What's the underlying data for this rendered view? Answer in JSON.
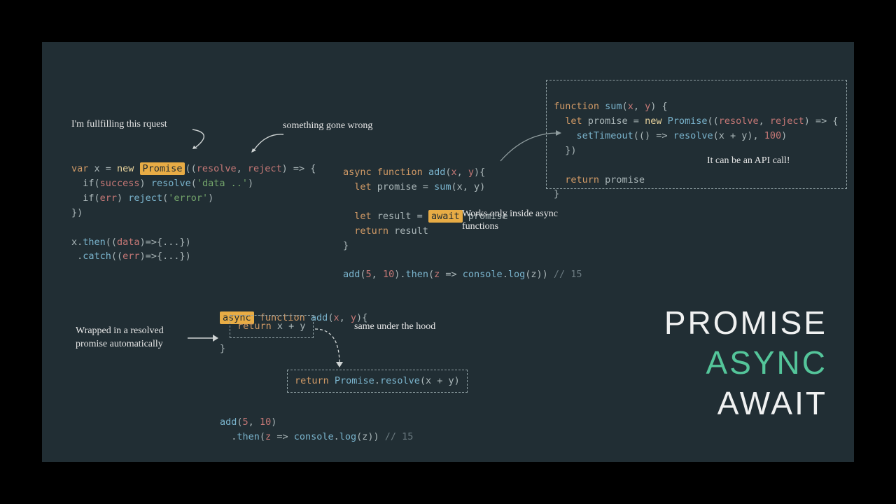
{
  "annotations": {
    "fulfilling": "I'm fullfilling this rquest",
    "wrong": "something gone wrong",
    "works_inside": "Works only inside async functions",
    "api_call": "It can be an API call!",
    "wrapped": "Wrapped in a resolved promise automatically",
    "same_hood": "same under the hood"
  },
  "titles": {
    "promise": "PROMISE",
    "async": "ASYNC",
    "await": "AWAIT"
  },
  "code": {
    "block1": {
      "l1a": "var",
      "l1b": " x = ",
      "l1c": "new ",
      "l1hl": "Promise",
      "l1d": "((",
      "l1e": "resolve",
      "l1f": ", ",
      "l1g": "reject",
      "l1h": ") => {",
      "l2a": "  if(",
      "l2b": "success",
      "l2c": ") ",
      "l2d": "resolve",
      "l2e": "(",
      "l2f": "'data ..'",
      "l2g": ")",
      "l3a": "  if(",
      "l3b": "err",
      "l3c": ") ",
      "l3d": "reject",
      "l3e": "(",
      "l3f": "'error'",
      "l3g": ")",
      "l4": "})",
      "l5a": "x.",
      "l5b": "then",
      "l5c": "((",
      "l5d": "data",
      "l5e": ")=>{...})",
      "l6a": " .",
      "l6b": "catch",
      "l6c": "((",
      "l6d": "err",
      "l6e": ")=>{...})"
    },
    "block2": {
      "l1a": "async ",
      "l1b": "function ",
      "l1c": "add",
      "l1d": "(",
      "l1e": "x",
      "l1f": ", ",
      "l1g": "y",
      "l1h": "){",
      "l2a": "  let ",
      "l2b": "promise = ",
      "l2c": "sum",
      "l2d": "(x, y)",
      "l3a": "  let ",
      "l3b": "result = ",
      "l3hl": "await",
      "l3c": " promise",
      "l4a": "  return ",
      "l4b": "result",
      "l5": "}",
      "l6a": "add",
      "l6b": "(",
      "l6c": "5",
      "l6d": ", ",
      "l6e": "10",
      "l6f": ").",
      "l6g": "then",
      "l6h": "(",
      "l6i": "z",
      "l6j": " => ",
      "l6k": "console",
      "l6l": ".",
      "l6m": "log",
      "l6n": "(z)) ",
      "l6o": "// 15"
    },
    "block3": {
      "l1a": "function ",
      "l1b": "sum",
      "l1c": "(",
      "l1d": "x",
      "l1e": ", ",
      "l1f": "y",
      "l1g": ") {",
      "l2a": "  let ",
      "l2b": "promise = ",
      "l2c": "new ",
      "l2d": "Promise",
      "l2e": "((",
      "l2f": "resolve",
      "l2g": ", ",
      "l2h": "reject",
      "l2i": ") => {",
      "l3a": "    setTimeout",
      "l3b": "(() => ",
      "l3c": "resolve",
      "l3d": "(x + y), ",
      "l3e": "100",
      "l3f": ")",
      "l4": "  })",
      "l5a": "  return ",
      "l5b": "promise",
      "l6": "}"
    },
    "block4": {
      "l1hl": "async",
      "l1a": " function ",
      "l1b": "add",
      "l1c": "(",
      "l1d": "x",
      "l1e": ", ",
      "l1f": "y",
      "l1g": "){",
      "l2a": "return ",
      "l2b": "x + y",
      "l3": "}",
      "l4a": "return ",
      "l4b": "Promise",
      "l4c": ".",
      "l4d": "resolve",
      "l4e": "(x + y)",
      "l5a": "add",
      "l5b": "(",
      "l5c": "5",
      "l5d": ", ",
      "l5e": "10",
      "l5f": ")",
      "l6a": "  .",
      "l6b": "then",
      "l6c": "(",
      "l6d": "z",
      "l6e": " => ",
      "l6f": "console",
      "l6g": ".",
      "l6h": "log",
      "l6i": "(z)) ",
      "l6j": "// 15"
    }
  }
}
